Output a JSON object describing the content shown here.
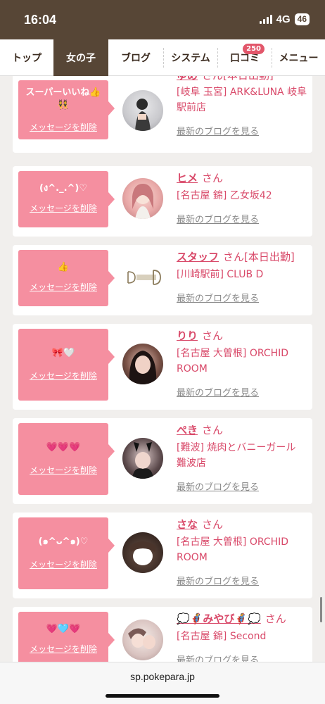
{
  "status": {
    "time": "16:04",
    "network": "4G",
    "battery": "46"
  },
  "nav": {
    "tabs": [
      {
        "label": "トップ"
      },
      {
        "label": "女の子"
      },
      {
        "label": "ブログ"
      },
      {
        "label": "システム"
      },
      {
        "label": "口コミ",
        "badge": "250"
      },
      {
        "label": "メニュー"
      }
    ]
  },
  "items": [
    {
      "message": "スーパーいいね👍👯",
      "delete": "メッセージを削除",
      "name": "ゆめ",
      "san": "さん",
      "tag": "[本日出勤]",
      "shop": "[岐阜 玉宮] ARK&LUNA 岐阜駅前店",
      "blog": "最新のブログを見る"
    },
    {
      "message": "(ง^._.^)♡",
      "delete": "メッセージを削除",
      "name": "ヒメ",
      "san": "さん",
      "tag": "",
      "shop": "[名古屋 錦] 乙女坂42",
      "blog": "最新のブログを見る"
    },
    {
      "message": "👍",
      "delete": "メッセージを削除",
      "name": "スタッフ",
      "san": "さん",
      "tag": "[本日出勤]",
      "shop": "[川崎駅前] CLUB D",
      "blog": "最新のブログを見る"
    },
    {
      "message": "🎀🤍",
      "delete": "メッセージを削除",
      "name": "りり",
      "san": "さん",
      "tag": "",
      "shop": "[名古屋 大曽根] ORCHID ROOM",
      "blog": "最新のブログを見る"
    },
    {
      "message": "💗💗💗",
      "delete": "メッセージを削除",
      "name": "ぺき",
      "san": "さん",
      "tag": "",
      "shop": "[難波] 焼肉とバニーガール 難波店",
      "blog": "最新のブログを見る"
    },
    {
      "message": "(๑^ᴗ^๑)♡",
      "delete": "メッセージを削除",
      "name": "さな",
      "san": "さん",
      "tag": "",
      "shop": "[名古屋 大曽根] ORCHID ROOM",
      "blog": "最新のブログを見る"
    },
    {
      "message": "💗🩵💗",
      "delete": "メッセージを削除",
      "name": "💭🦸みやび🦸💭",
      "san": "さん",
      "tag": "",
      "shop": "[名古屋 錦] Second",
      "blog": "最新のブログを見る"
    }
  ],
  "url": "sp.pokepara.jp",
  "colors": {
    "brown": "#574636",
    "pink": "#f58fa0",
    "link": "#d94a6a"
  }
}
